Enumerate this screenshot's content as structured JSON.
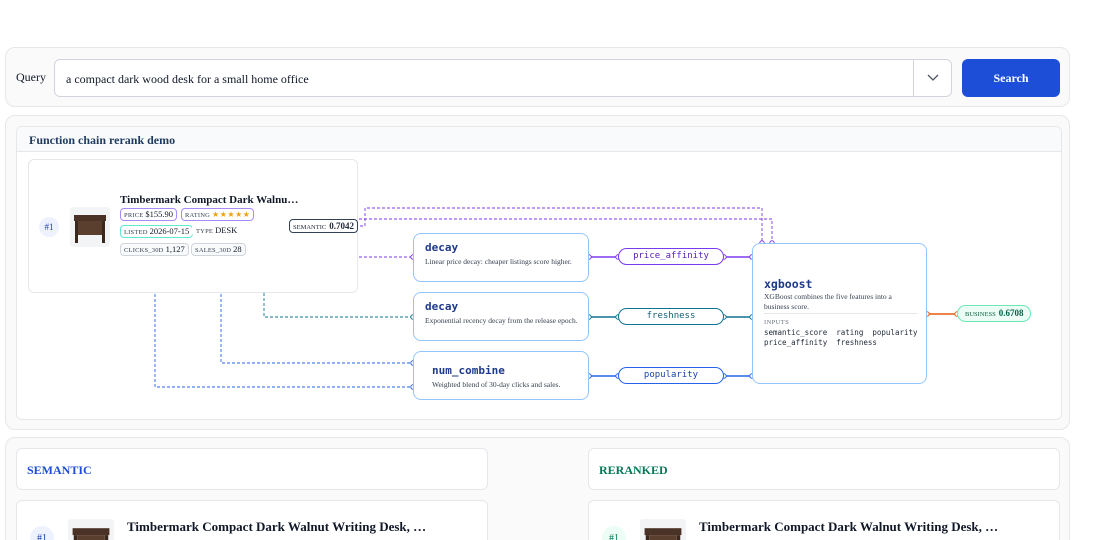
{
  "query": {
    "label": "Query",
    "value": "a compact dark wood desk for a small home office",
    "search_label": "Search"
  },
  "demo": {
    "title": "Function chain rerank demo",
    "product": {
      "rank": "#1",
      "name": "Timbermark Compact Dark Walnu…",
      "price_key": "PRICE",
      "price": "$155.90",
      "rating_key": "RATING",
      "rating_stars": "★★★★★",
      "listed_key": "LISTED",
      "listed": "2026-07-15",
      "type_key": "TYPE",
      "type": "DESK",
      "clicks_key": "CLICKS_30D",
      "clicks": "1,127",
      "sales_key": "SALES_30D",
      "sales": "28"
    },
    "semantic": {
      "key": "SEMANTIC",
      "value": "0.7042"
    },
    "nodes": {
      "decay1": {
        "name": "decay",
        "desc": "Linear price decay: cheaper listings score higher."
      },
      "decay2": {
        "name": "decay",
        "desc": "Exponential recency decay from the release epoch."
      },
      "num_combine": {
        "name": "num_combine",
        "desc": "Weighted blend of 30-day clicks and sales."
      },
      "xgboost": {
        "name": "xgboost",
        "desc": "XGBoost combines the five features into a business score.",
        "inputs_label": "INPUTS",
        "inputs_line1": "semantic_score  rating  popularity",
        "inputs_line2": "price_affinity  freshness"
      }
    },
    "features": {
      "price_affinity": "price_affinity",
      "freshness": "freshness",
      "popularity": "popularity"
    },
    "business": {
      "key": "BUSINESS",
      "value": "0.6708"
    },
    "colors": {
      "purple": "#7c3aed",
      "teal": "#0e7490",
      "blue": "#2563eb",
      "orange": "#ea580c",
      "accent": "#1d4ed8"
    }
  },
  "results": {
    "semantic": {
      "title": "SEMANTIC",
      "rank": "#1",
      "name": "Timbermark Compact Dark Walnut Writing Desk, …"
    },
    "reranked": {
      "title": "RERANKED",
      "rank": "#1",
      "name": "Timbermark Compact Dark Walnut Writing Desk, …"
    }
  }
}
